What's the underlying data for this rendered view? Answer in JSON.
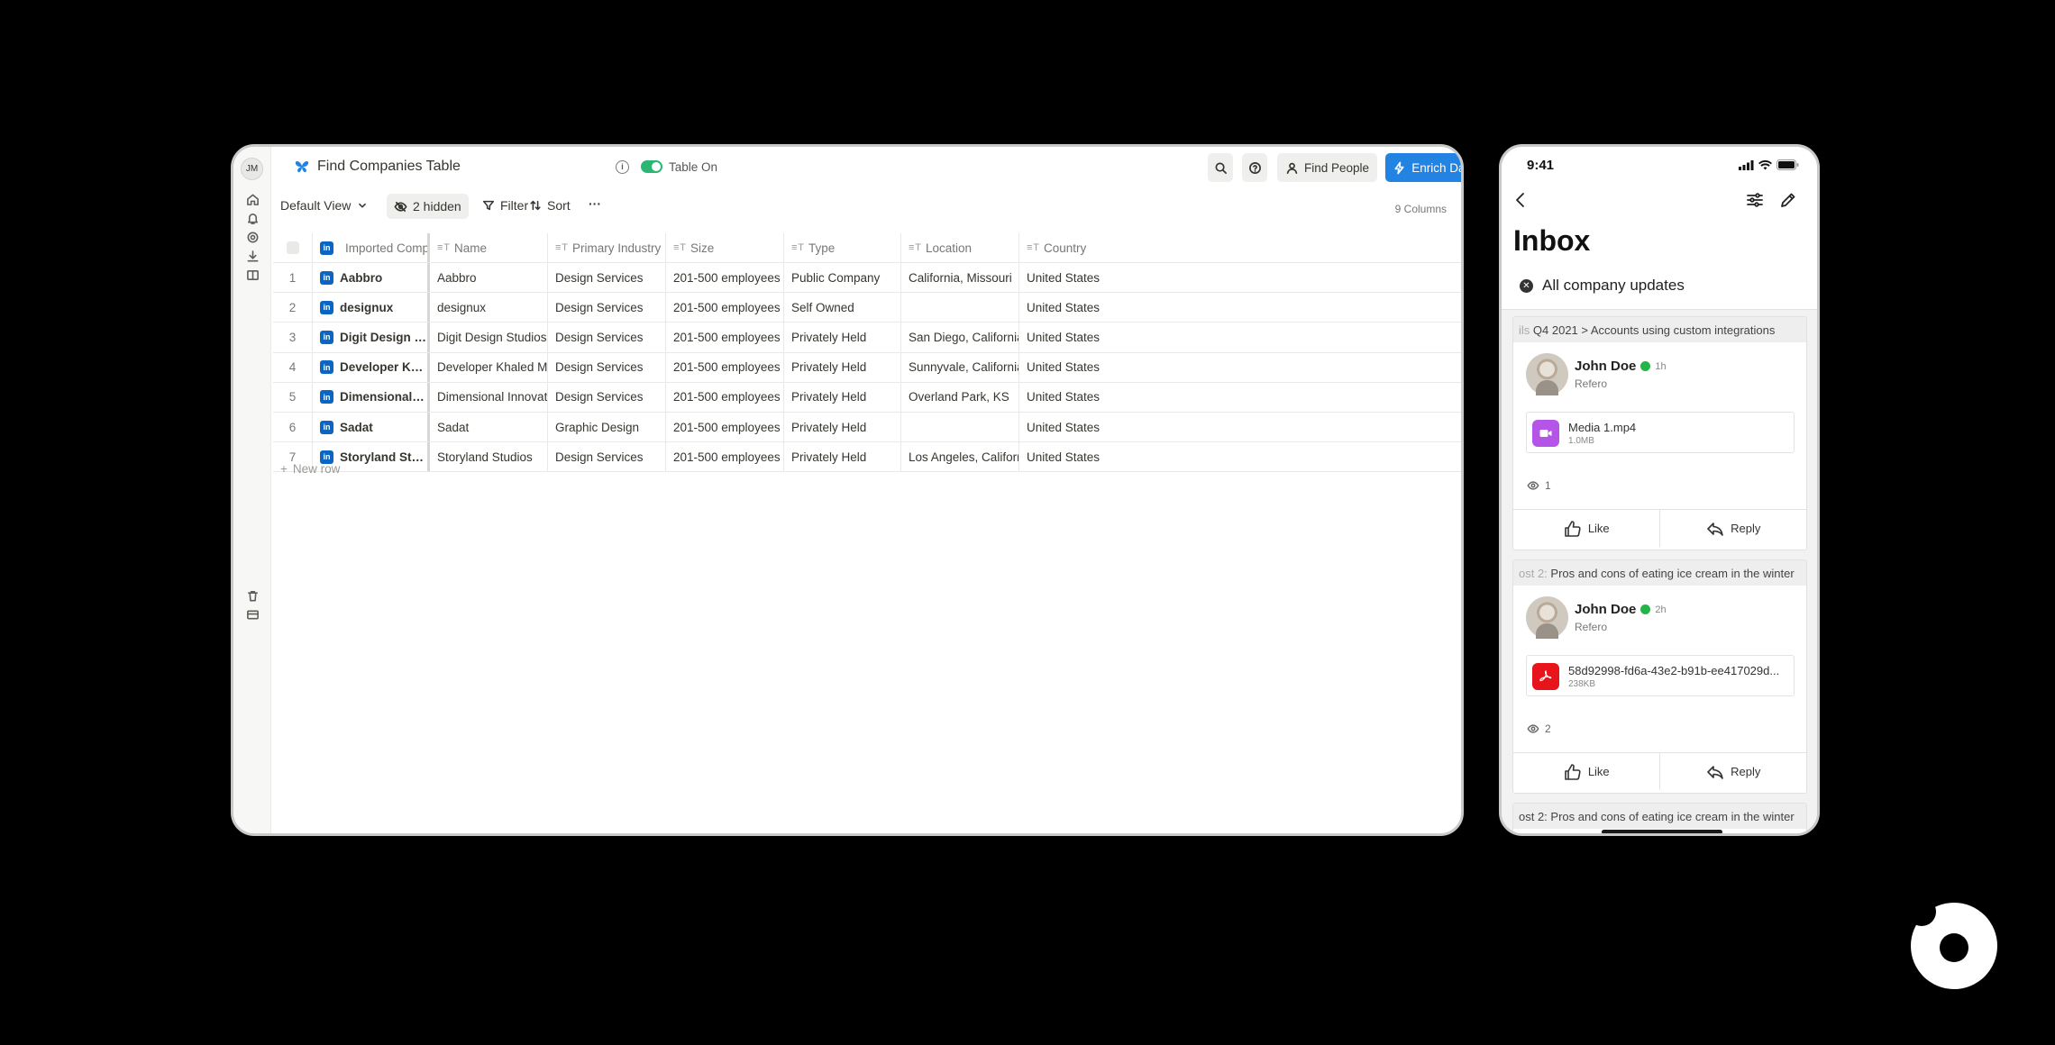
{
  "app": {
    "user_initials": "JM",
    "table_title": "Find Companies Table",
    "toggle_label": "Table On",
    "find_people_label": "Find People",
    "enrich_label": "Enrich Data",
    "accent": "#2383e2"
  },
  "toolbar": {
    "view_label": "Default View",
    "hidden_label": "2 hidden",
    "filter_label": "Filter",
    "sort_label": "Sort",
    "more_label": "···",
    "columns_count": "9 Columns"
  },
  "table": {
    "headers": [
      "Imported Companies",
      "Name",
      "Primary Industry",
      "Size",
      "Type",
      "Location",
      "Country"
    ],
    "rows": [
      {
        "num": "1",
        "company": "Aabbro",
        "name": "Aabbro",
        "industry": "Design Services",
        "size": "201-500 employees",
        "type": "Public Company",
        "location": "California, Missouri",
        "country": "United States"
      },
      {
        "num": "2",
        "company": "designux",
        "name": "designux",
        "industry": "Design Services",
        "size": "201-500 employees",
        "type": "Self Owned",
        "location": "",
        "country": "United States"
      },
      {
        "num": "3",
        "company": "Digit Design Studios",
        "name": "Digit Design Studios",
        "industry": "Design Services",
        "size": "201-500 employees",
        "type": "Privately Held",
        "location": "San Diego, California",
        "country": "United States"
      },
      {
        "num": "4",
        "company": "Developer Khaled Mu...",
        "name": "Developer Khaled Musarraf",
        "industry": "Design Services",
        "size": "201-500 employees",
        "type": "Privately Held",
        "location": "Sunnyvale, California",
        "country": "United States"
      },
      {
        "num": "5",
        "company": "Dimensional Innovati...",
        "name": "Dimensional Innovations",
        "industry": "Design Services",
        "size": "201-500 employees",
        "type": "Privately Held",
        "location": "Overland Park, KS",
        "country": "United States"
      },
      {
        "num": "6",
        "company": "Sadat",
        "name": "Sadat",
        "industry": "Graphic Design",
        "size": "201-500 employees",
        "type": "Privately Held",
        "location": "",
        "country": "United States"
      },
      {
        "num": "7",
        "company": "Storyland Studios",
        "name": "Storyland Studios",
        "industry": "Design Services",
        "size": "201-500 employees",
        "type": "Privately Held",
        "location": "Los Angeles, California",
        "country": "United States"
      }
    ],
    "new_row_label": "New row",
    "linkedin_glyph": "in"
  },
  "phone": {
    "time": "9:41",
    "title": "Inbox",
    "filter_label": "All company updates",
    "posts": [
      {
        "crumb_fade": "ils",
        "crumb": "Q4 2021  >  Accounts using custom integrations",
        "author": "John Doe",
        "ago": "1h",
        "org": "Refero",
        "attachment_name": "Media 1.mp4",
        "attachment_size": "1.0MB",
        "attachment_color": "#b455e8",
        "views": "1",
        "like_label": "Like",
        "reply_label": "Reply"
      },
      {
        "crumb_fade": "ost 2:",
        "crumb": " Pros and cons of eating ice cream in the winter",
        "author": "John Doe",
        "ago": "2h",
        "org": "Refero",
        "attachment_name": "58d92998-fd6a-43e2-b91b-ee417029d...",
        "attachment_size": "238KB",
        "attachment_color": "#e8141c",
        "views": "2",
        "like_label": "Like",
        "reply_label": "Reply"
      }
    ],
    "peek_crumb": "ost 2: Pros and cons of eating ice cream in the winter"
  }
}
